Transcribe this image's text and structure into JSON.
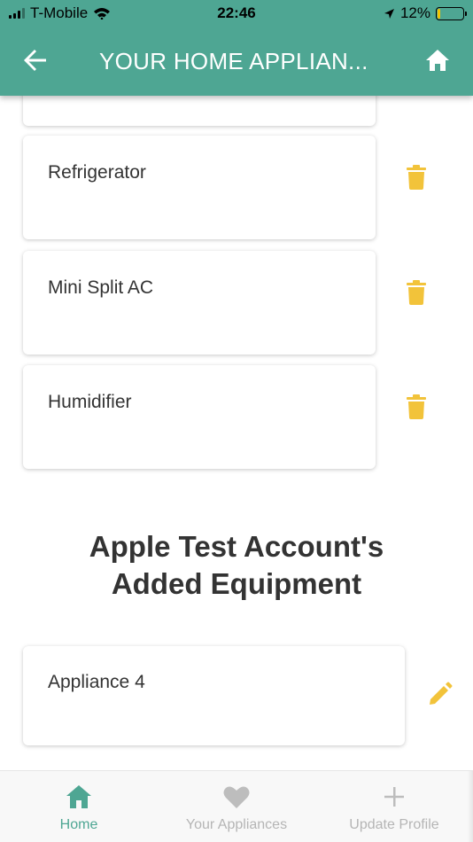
{
  "status_bar": {
    "carrier": "T-Mobile",
    "time": "22:46",
    "battery_percent": "12%",
    "battery_level": 0.12,
    "icons": [
      "signal-icon",
      "wifi-icon",
      "location-arrow-icon",
      "battery-icon"
    ]
  },
  "header": {
    "title": "YOUR HOME APPLIAN...",
    "back_icon": "arrow-left-icon",
    "home_icon": "home-icon",
    "color": "#4ea693"
  },
  "appliances": [
    {
      "label": ""
    },
    {
      "label": "Refrigerator"
    },
    {
      "label": "Mini Split AC"
    },
    {
      "label": "Humidifier"
    }
  ],
  "added_section": {
    "title_line1": "Apple Test Account's",
    "title_line2": "Added Equipment",
    "items": [
      {
        "label": "Appliance 4"
      }
    ]
  },
  "accent_color": "#f2c33a",
  "bottom_nav": {
    "items": [
      {
        "label": "Home",
        "icon": "home-icon",
        "active": true
      },
      {
        "label": "Your Appliances",
        "icon": "heart-icon",
        "active": false
      },
      {
        "label": "Update Profile",
        "icon": "plus-icon",
        "active": false
      }
    ]
  }
}
